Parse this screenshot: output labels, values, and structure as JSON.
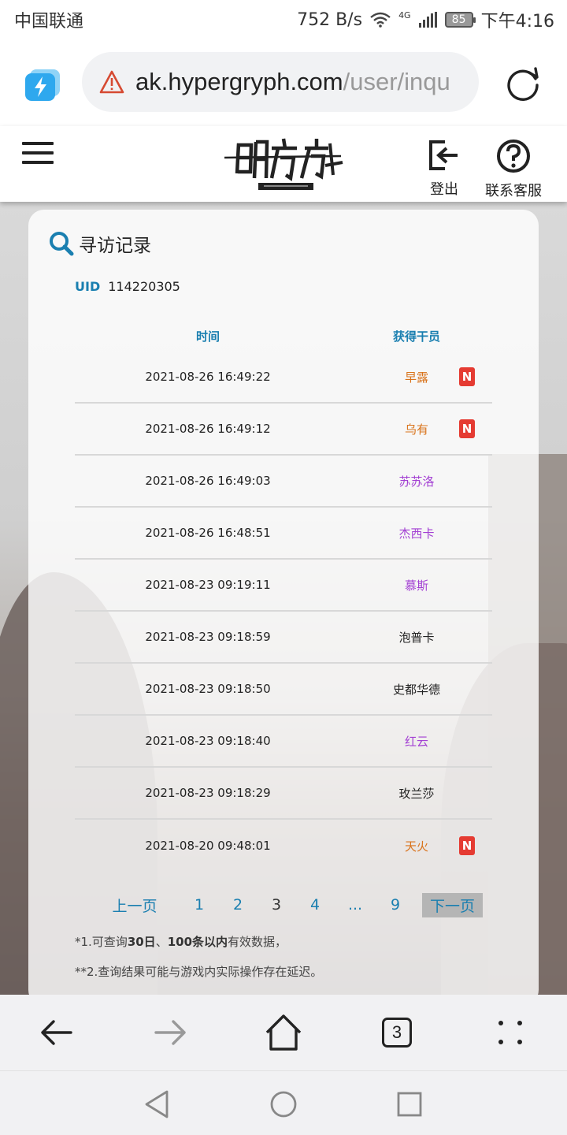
{
  "status_bar": {
    "carrier": "中国联通",
    "net_speed": "752 B/s",
    "network_type": "4G",
    "battery": "85",
    "time": "下午4:16"
  },
  "browser": {
    "url_domain": "ak.hypergryph.com",
    "url_path": "/user/inqu",
    "tab_count": "3"
  },
  "header": {
    "logout_label": "登出",
    "help_label": "联系客服"
  },
  "card": {
    "title": "寻访记录",
    "uid_label": "UID",
    "uid_value": "114220305",
    "col_time": "时间",
    "col_operator": "获得干员",
    "new_badge": "N",
    "records": [
      {
        "time": "2021-08-26 16:49:22",
        "operator": "早露",
        "color": "#d9731b",
        "is_new": true
      },
      {
        "time": "2021-08-26 16:49:12",
        "operator": "乌有",
        "color": "#d9731b",
        "is_new": true
      },
      {
        "time": "2021-08-26 16:49:03",
        "operator": "苏苏洛",
        "color": "#a340d3",
        "is_new": false
      },
      {
        "time": "2021-08-26 16:48:51",
        "operator": "杰西卡",
        "color": "#a340d3",
        "is_new": false
      },
      {
        "time": "2021-08-23 09:19:11",
        "operator": "慕斯",
        "color": "#a340d3",
        "is_new": false
      },
      {
        "time": "2021-08-23 09:18:59",
        "operator": "泡普卡",
        "color": "#222222",
        "is_new": false
      },
      {
        "time": "2021-08-23 09:18:50",
        "operator": "史都华德",
        "color": "#222222",
        "is_new": false
      },
      {
        "time": "2021-08-23 09:18:40",
        "operator": "红云",
        "color": "#a340d3",
        "is_new": false
      },
      {
        "time": "2021-08-23 09:18:29",
        "operator": "玫兰莎",
        "color": "#222222",
        "is_new": false
      },
      {
        "time": "2021-08-20 09:48:01",
        "operator": "天火",
        "color": "#d9731b",
        "is_new": true
      }
    ],
    "pagination": {
      "prev": "上一页",
      "pages": [
        "1",
        "2",
        "3",
        "4",
        "...",
        "9"
      ],
      "current": "3",
      "next": "下一页"
    },
    "note1_prefix": "*1.可查询",
    "note1_bold1": "30日",
    "note1_sep": "、",
    "note1_bold2": "100条以内",
    "note1_suffix": "有效数据，",
    "note2": "**2.查询结果可能与游戏内实际操作存在延迟。"
  }
}
